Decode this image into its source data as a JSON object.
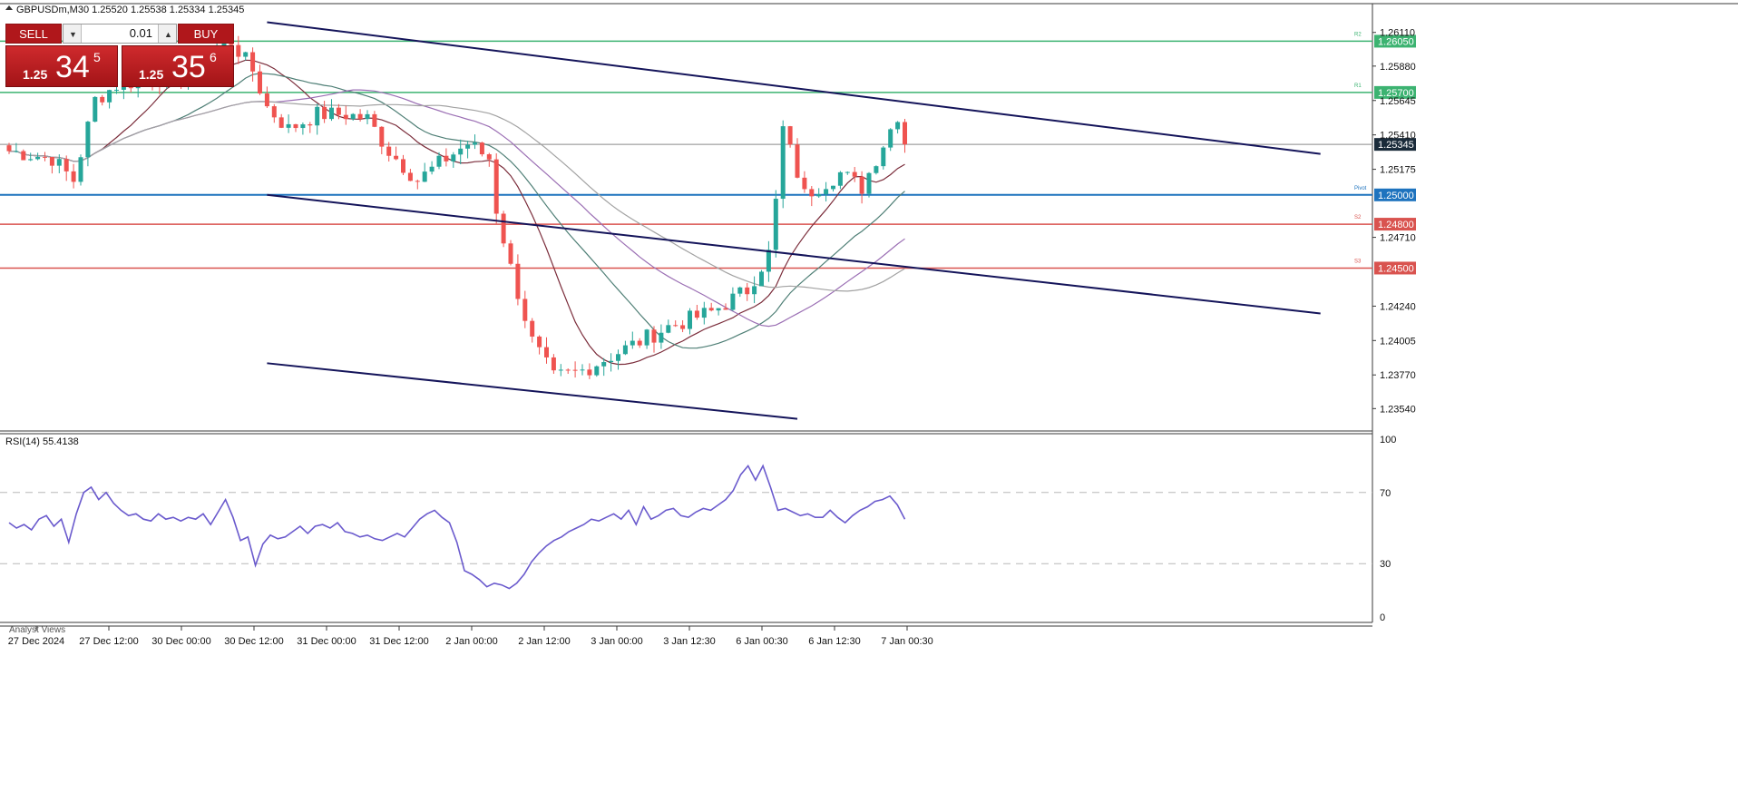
{
  "header": {
    "symbol_info": "GBPUSDm,M30  1.25520 1.25538 1.25334 1.25345"
  },
  "trade_panel": {
    "sell_label": "SELL",
    "buy_label": "BUY",
    "lot_value": "0.01",
    "sell_price": {
      "small": "1.25",
      "big": "34",
      "sup": "5"
    },
    "buy_price": {
      "small": "1.25",
      "big": "35",
      "sup": "6"
    }
  },
  "colors": {
    "bull": "#26a69a",
    "bear": "#ef5350",
    "green_level": "#3cb371",
    "blue_level": "#1e73be",
    "red_level": "#d9534f",
    "rsi": "#6a5acd",
    "channel": "#14145a"
  },
  "chart_data": [
    {
      "type": "candlestick",
      "title": "GBPUSDm,M30",
      "x_labels": [
        "27 Dec 2024",
        "27 Dec 12:00",
        "30 Dec 00:00",
        "30 Dec 12:00",
        "31 Dec 00:00",
        "31 Dec 12:00",
        "2 Jan 00:00",
        "2 Jan 12:00",
        "3 Jan 00:00",
        "3 Jan 12:30",
        "6 Jan 00:30",
        "6 Jan 12:30",
        "7 Jan 00:30"
      ],
      "y_ticks": [
        "1.26110",
        "1.25880",
        "1.25645",
        "1.25410",
        "1.25175",
        "1.24710",
        "1.24240",
        "1.24005",
        "1.23770",
        "1.23540"
      ],
      "ylim": [
        1.2348,
        1.2622
      ],
      "bars": 126,
      "price_path": [
        [
          0,
          1.253
        ],
        [
          6,
          1.2525
        ],
        [
          9,
          1.251
        ],
        [
          12,
          1.2565
        ],
        [
          15,
          1.2575
        ],
        [
          20,
          1.258
        ],
        [
          26,
          1.2585
        ],
        [
          28,
          1.2595
        ],
        [
          31,
          1.2605
        ],
        [
          34,
          1.2585
        ],
        [
          36,
          1.256
        ],
        [
          39,
          1.2545
        ],
        [
          43,
          1.2555
        ],
        [
          47,
          1.2555
        ],
        [
          50,
          1.2552
        ],
        [
          53,
          1.253
        ],
        [
          57,
          1.251
        ],
        [
          61,
          1.2525
        ],
        [
          64,
          1.2535
        ],
        [
          67,
          1.2525
        ],
        [
          68,
          1.249
        ],
        [
          70,
          1.245
        ],
        [
          73,
          1.24
        ],
        [
          76,
          1.2375
        ],
        [
          80,
          1.238
        ],
        [
          86,
          1.2395
        ],
        [
          92,
          1.241
        ],
        [
          98,
          1.242
        ],
        [
          103,
          1.2435
        ],
        [
          106,
          1.246
        ],
        [
          107,
          1.2495
        ],
        [
          108,
          1.2545
        ],
        [
          111,
          1.25
        ],
        [
          116,
          1.2515
        ],
        [
          119,
          1.2505
        ],
        [
          122,
          1.2535
        ],
        [
          124,
          1.2555
        ],
        [
          125,
          1.2534
        ]
      ],
      "last_price": "1.25345",
      "levels": [
        {
          "label": "1.26050",
          "value": 1.2605,
          "color": "green",
          "tag": "R2"
        },
        {
          "label": "1.25700",
          "value": 1.257,
          "color": "green",
          "tag": "R1"
        },
        {
          "label": "1.25000",
          "value": 1.25,
          "color": "blue",
          "tag": "Pivot"
        },
        {
          "label": "1.24800",
          "value": 1.248,
          "color": "red",
          "tag": "S2"
        },
        {
          "label": "1.24500",
          "value": 1.245,
          "color": "red",
          "tag": "S3"
        }
      ],
      "channel_lines": [
        {
          "from": [
            36,
            1.2618
          ],
          "to": [
            183,
            1.2528
          ]
        },
        {
          "from": [
            36,
            1.25
          ],
          "to": [
            183,
            1.2419
          ]
        },
        {
          "from": [
            36,
            1.2385
          ],
          "to": [
            110,
            1.2347
          ]
        }
      ],
      "moving_averages": 4
    },
    {
      "type": "line",
      "title": "RSI(14) 55.4138",
      "y_ticks": [
        "100",
        "70",
        "30",
        "0"
      ],
      "levels": [
        70,
        30
      ],
      "ylim": [
        0,
        100
      ],
      "series": [
        {
          "values": [
            53,
            50,
            52,
            49,
            55,
            57,
            51,
            55,
            42,
            58,
            70,
            73,
            66,
            70,
            64,
            60,
            57,
            58,
            55,
            54,
            58,
            55,
            56,
            54,
            56,
            55,
            58,
            52,
            59,
            66,
            56,
            43,
            45,
            29,
            41,
            46,
            44,
            45,
            48,
            51,
            47,
            51,
            52,
            50,
            53,
            48,
            47,
            45,
            46,
            44,
            43,
            45,
            47,
            45,
            50,
            55,
            58,
            60,
            56,
            53,
            42,
            26,
            24,
            21,
            17,
            19,
            18,
            16,
            19,
            24,
            31,
            36,
            40,
            43,
            45,
            48,
            50,
            52,
            55,
            54,
            56,
            58,
            55,
            60,
            52,
            62,
            55,
            57,
            60,
            61,
            57,
            56,
            59,
            61,
            60,
            63,
            66,
            71,
            80,
            85,
            77,
            85,
            73,
            60,
            61,
            59,
            57,
            58,
            56,
            56,
            60,
            56,
            53,
            57,
            60,
            62,
            65,
            66,
            68,
            63,
            55
          ]
        }
      ]
    }
  ],
  "analyst_views_label": "Analyst Views"
}
